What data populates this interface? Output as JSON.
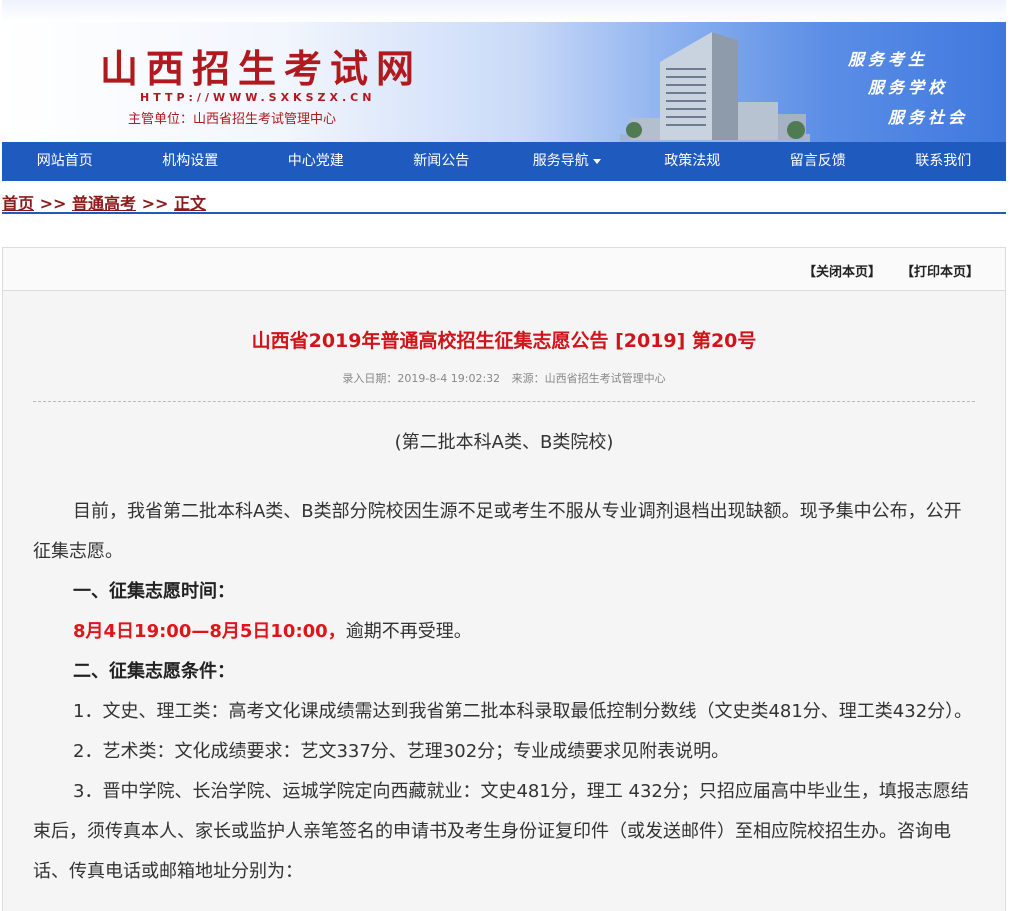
{
  "header": {
    "title": "山西招生考试网",
    "url": "HTTP://WWW.SXKSZX.CN",
    "sponsor": "主管单位：山西省招生考试管理中心",
    "slogans": [
      "服务考生",
      "服务学校",
      "服务社会"
    ]
  },
  "nav": {
    "items": [
      {
        "label": "网站首页"
      },
      {
        "label": "机构设置"
      },
      {
        "label": "中心党建"
      },
      {
        "label": "新闻公告"
      },
      {
        "label": "服务导航"
      },
      {
        "label": "政策法规"
      },
      {
        "label": "留言反馈"
      },
      {
        "label": "联系我们"
      }
    ]
  },
  "breadcrumb": {
    "home": "首页",
    "sep": ">>",
    "category": "普通高考",
    "current": "正文"
  },
  "toolbar": {
    "close": "【关闭本页】",
    "print": "【打印本页】"
  },
  "article": {
    "title": "山西省2019年普通高校招生征集志愿公告 [2019] 第20号",
    "date": "录入日期：2019-8-4 19:02:32",
    "source": "来源：山西省招生考试管理中心",
    "subtitle": "(第二批本科A类、B类院校)",
    "p1": "目前，我省第二批本科A类、B类部分院校因生源不足或考生不服从专业调剂退档出现缺额。现予集中公布，公开征集志愿。",
    "h1": "一、征集志愿时间：",
    "time_red": "8月4日19:00—8月5日10:00，",
    "time_rest": "逾期不再受理。",
    "h2": "二、征集志愿条件：",
    "c1": "1．文史、理工类：高考文化课成绩需达到我省第二批本科录取最低控制分数线（文史类481分、理工类432分）。",
    "c2": "2．艺术类：文化成绩要求：艺文337分、艺理302分；专业成绩要求见附表说明。",
    "c3": "3．晋中学院、长治学院、运城学院定向西藏就业：文史481分，理工 432分；只招应届高中毕业生，填报志愿结束后，须传真本人、家长或监护人亲笔签名的申请书及考生身份证复印件（或发送邮件）至相应院校招生办。咨询电话、传真电话或邮箱地址分别为："
  }
}
